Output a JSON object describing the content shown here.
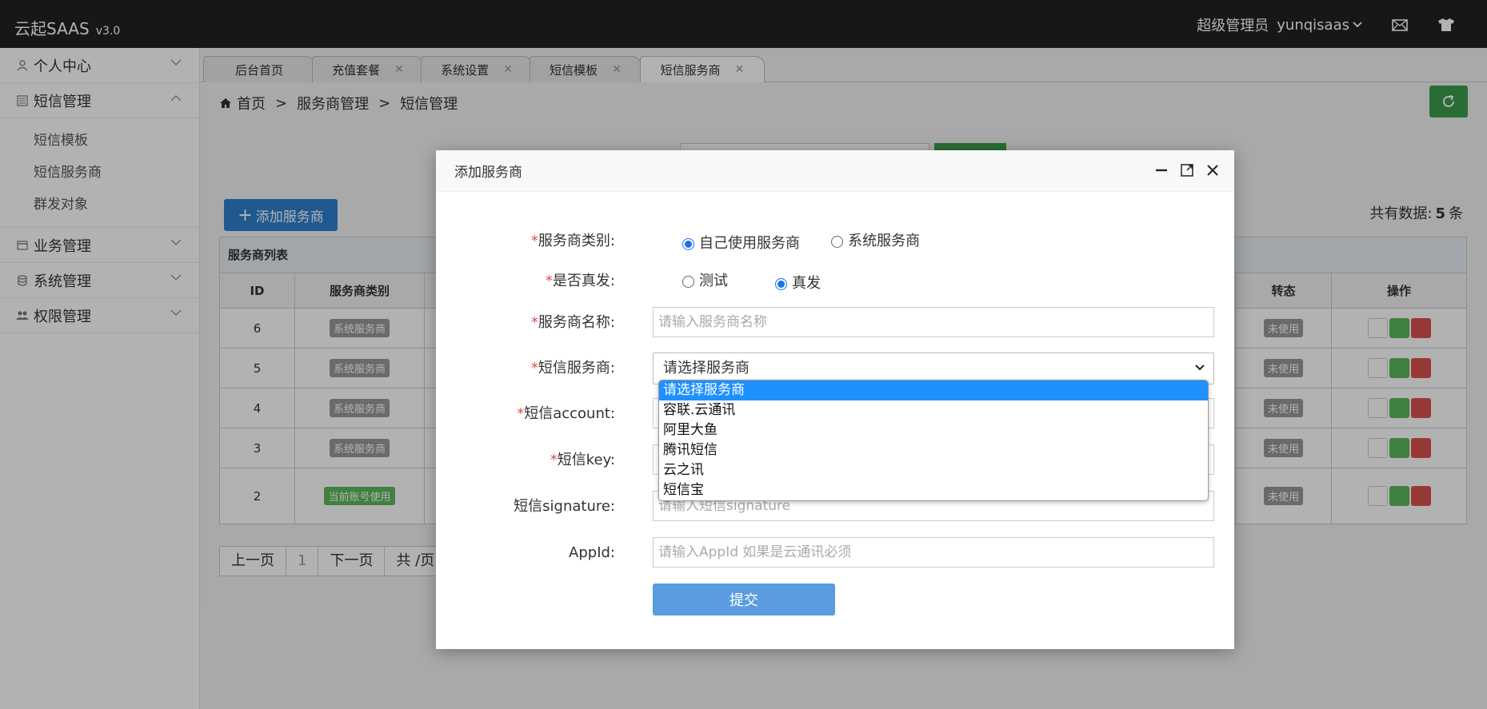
{
  "topbar": {
    "brand": "云起SAAS",
    "version": "v3.0",
    "user_role": "超级管理员",
    "username": "yunqisaas"
  },
  "sidebar": {
    "items": [
      {
        "label": "个人中心",
        "icon": "user-icon"
      },
      {
        "label": "短信管理",
        "icon": "document-icon",
        "expanded": true
      },
      {
        "label": "业务管理",
        "icon": "card-icon"
      },
      {
        "label": "系统管理",
        "icon": "database-icon"
      },
      {
        "label": "权限管理",
        "icon": "users-icon"
      }
    ],
    "subitems": [
      "短信模板",
      "短信服务商",
      "群发对象"
    ]
  },
  "tabs": [
    {
      "label": "后台首页",
      "closable": false
    },
    {
      "label": "充值套餐",
      "closable": true
    },
    {
      "label": "系统设置",
      "closable": true
    },
    {
      "label": "短信模板",
      "closable": true
    },
    {
      "label": "短信服务商",
      "closable": true,
      "active": true
    }
  ],
  "breadcrumb": [
    "首页",
    "服务商管理",
    "短信管理"
  ],
  "main": {
    "add_button": "添加服务商",
    "total_label": "共有数据:",
    "total_count": "5",
    "total_unit": "条",
    "table_title": "服务商列表"
  },
  "table": {
    "headers": [
      "ID",
      "服务商类别",
      "转态",
      "操作"
    ],
    "rows": [
      {
        "id": "6",
        "type": "系统服务商",
        "status": "未使用"
      },
      {
        "id": "5",
        "type": "系统服务商",
        "status": "未使用"
      },
      {
        "id": "4",
        "type": "系统服务商",
        "status": "未使用"
      },
      {
        "id": "3",
        "type": "系统服务商",
        "status": "未使用"
      },
      {
        "id": "2",
        "type": "当前账号使用",
        "status": "未使用"
      }
    ]
  },
  "pager": {
    "prev": "上一页",
    "current": "1",
    "next": "下一页",
    "total": "共 /页"
  },
  "dialog": {
    "title": "添加服务商",
    "fields": {
      "category_label": "服务商类别:",
      "category_options": [
        "自己使用服务商",
        "系统服务商"
      ],
      "category_selected": "自己使用服务商",
      "real_label": "是否真发:",
      "real_options": [
        "测试",
        "真发"
      ],
      "real_selected": "真发",
      "name_label": "服务商名称:",
      "name_placeholder": "请输入服务商名称",
      "provider_label": "短信服务商:",
      "provider_value": "请选择服务商",
      "account_label": "短信account:",
      "key_label": "短信key:",
      "signature_label": "短信signature:",
      "signature_placeholder": "请输入短信signature",
      "appid_label": "AppId:",
      "appid_placeholder": "请输入AppId  如果是云通讯必须"
    },
    "submit": "提交",
    "required_mark": "*"
  },
  "dropdown": {
    "options": [
      "请选择服务商",
      "容联.云通讯",
      "阿里大鱼",
      "腾讯短信",
      "云之讯",
      "短信宝"
    ],
    "highlighted": "请选择服务商"
  },
  "colors": {
    "topbar": "#222222",
    "primary": "#2f7fce",
    "success": "#3a9d4c",
    "danger": "#d9534f",
    "highlight": "#1e90ff"
  }
}
